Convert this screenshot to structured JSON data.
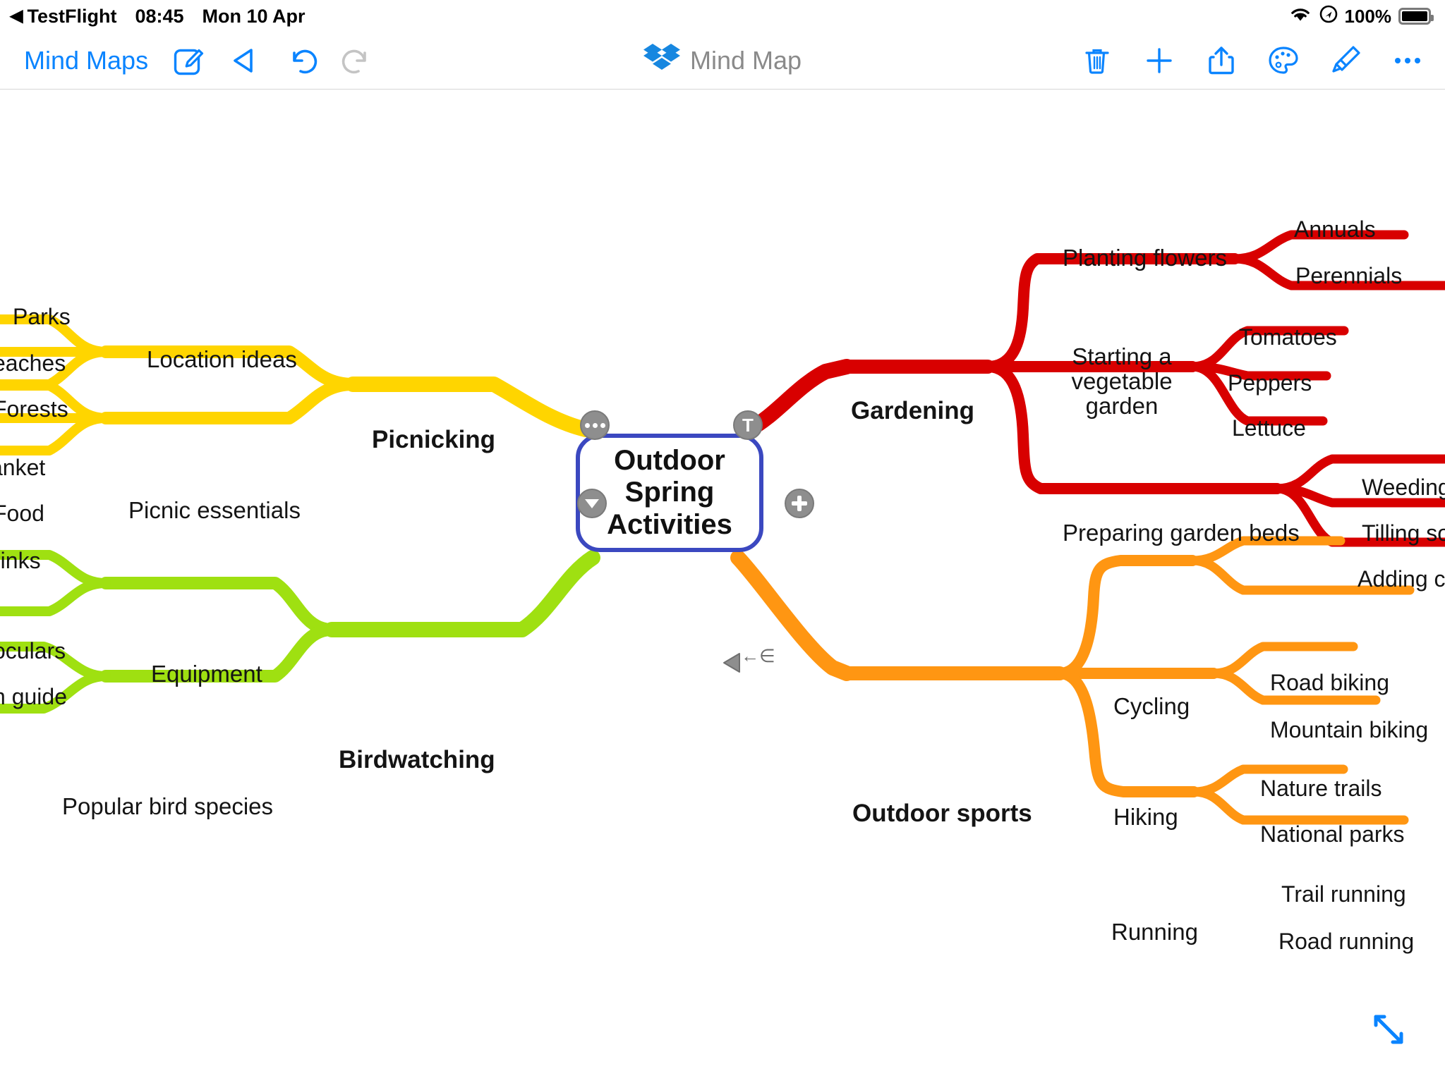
{
  "status_bar": {
    "back_arrow": "◀",
    "back_app": "TestFlight",
    "time": "08:45",
    "date": "Mon 10 Apr",
    "wifi_icon": "wifi-icon",
    "location_icon": "location-icon",
    "battery_percent": "100%",
    "battery_icon": "battery-full-icon"
  },
  "toolbar": {
    "back_label": "Mind Maps",
    "compose_icon": "compose-icon",
    "present_icon": "play-triangle-icon",
    "undo_icon": "undo-icon",
    "redo_icon": "redo-icon",
    "app_title": "Mind Map",
    "app_logo": "dropbox-logo-icon",
    "delete_icon": "trash-icon",
    "add_icon": "plus-icon",
    "share_icon": "share-icon",
    "palette_icon": "palette-icon",
    "brush_icon": "paintbrush-icon",
    "more_icon": "ellipsis-icon"
  },
  "canvas": {
    "expand_icon": "expand-diagonal-arrows-icon",
    "handles": {
      "more": "…",
      "text": "T",
      "collapse": "▼",
      "add": "+",
      "drag": "drag-arrow-icon",
      "relationship": "←∈"
    }
  },
  "colors": {
    "accent_blue": "#0a84ff",
    "root_border": "#3b48c0",
    "picnicking": "#FFD500",
    "gardening": "#D80000",
    "birdwatching": "#9FE011",
    "outdoor_sports": "#FF9612",
    "title_gray": "#8a8a8a"
  },
  "mindmap": {
    "root": "Outdoor\nSpring\nActivities",
    "root_line1": "Outdoor",
    "root_line2": "Spring",
    "root_line3": "Activities",
    "branches": [
      {
        "label": "Picnicking",
        "color": "#FFD500",
        "children": [
          {
            "label": "Location ideas",
            "children": [
              {
                "label": "Parks",
                "clipped": false
              },
              {
                "label": "eaches",
                "clipped": true
              },
              {
                "label": "Forests",
                "clipped": true
              }
            ]
          },
          {
            "label": "Picnic essentials",
            "children": [
              {
                "label": "anket",
                "clipped": true
              },
              {
                "label": "Food",
                "clipped": true
              },
              {
                "label": "rinks",
                "clipped": true
              }
            ]
          }
        ]
      },
      {
        "label": "Gardening",
        "color": "#D80000",
        "children": [
          {
            "label": "Planting flowers",
            "children": [
              {
                "label": "Annuals"
              },
              {
                "label": "Perennials"
              }
            ]
          },
          {
            "label": "Starting a vegetable garden",
            "line1": "Starting a",
            "line2": "vegetable",
            "line3": "garden",
            "children": [
              {
                "label": "Tomatoes"
              },
              {
                "label": "Peppers"
              },
              {
                "label": "Lettuce"
              }
            ]
          },
          {
            "label": "Preparing garden beds",
            "children": [
              {
                "label": "Weeding",
                "clipped": true
              },
              {
                "label": "Tilling soi",
                "clipped": true
              },
              {
                "label": "Adding c",
                "clipped": true
              }
            ]
          }
        ]
      },
      {
        "label": "Birdwatching",
        "color": "#9FE011",
        "children": [
          {
            "label": "Equipment",
            "children": [
              {
                "label": "oculars",
                "clipped": true
              },
              {
                "label": "n guide",
                "clipped": true
              }
            ]
          },
          {
            "label": "Popular bird species",
            "children": []
          }
        ]
      },
      {
        "label": "Outdoor sports",
        "color": "#FF9612",
        "children": [
          {
            "label": "Cycling",
            "children": [
              {
                "label": "Road biking"
              },
              {
                "label": "Mountain biking"
              }
            ]
          },
          {
            "label": "Hiking",
            "children": [
              {
                "label": "Nature trails"
              },
              {
                "label": "National parks"
              }
            ]
          },
          {
            "label": "Running",
            "children": [
              {
                "label": "Trail running"
              },
              {
                "label": "Road running"
              }
            ]
          }
        ]
      }
    ]
  }
}
